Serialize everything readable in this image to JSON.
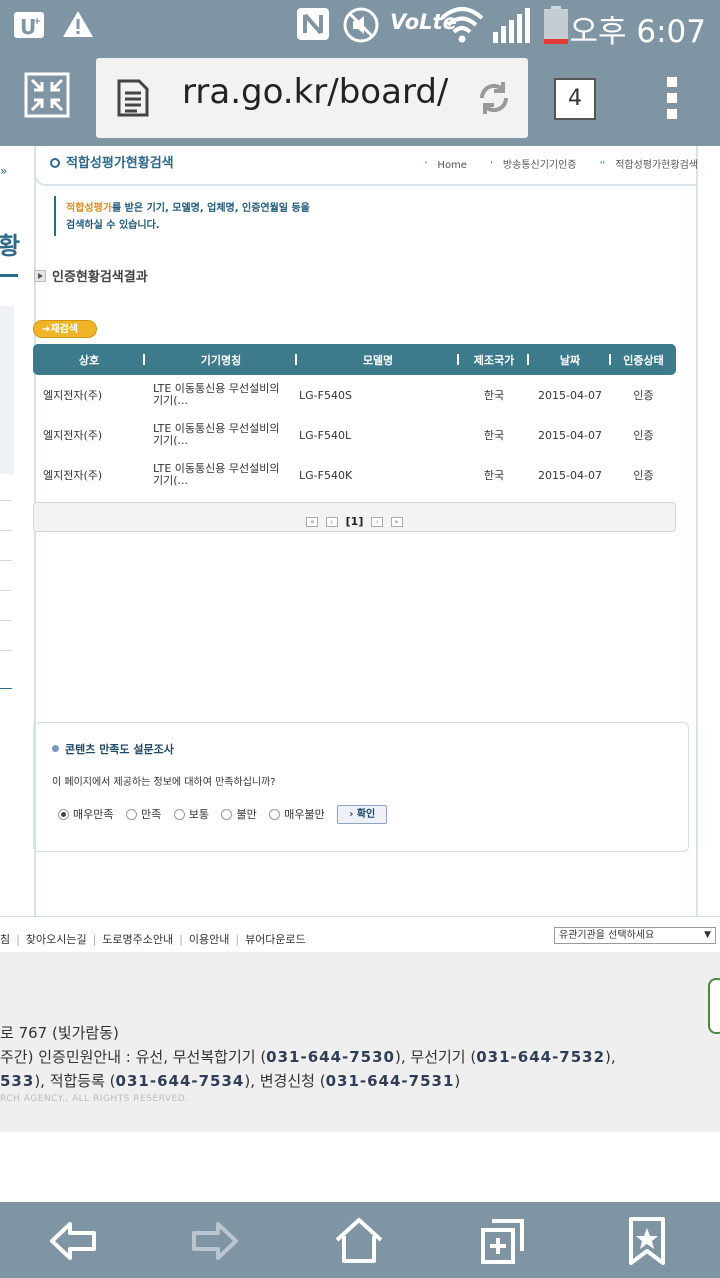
{
  "status_bar": {
    "time": "오후 6:07",
    "icons": [
      "uplus-icon",
      "warning-icon",
      "nfc-icon",
      "mute-icon",
      "volte-icon",
      "wifi-icon",
      "signal-icon",
      "battery-icon"
    ],
    "volte_label": "VoLte"
  },
  "browser": {
    "url": "rra.go.kr/board/c",
    "tab_count": "4",
    "icons": [
      "collapse-icon",
      "reader-icon",
      "reload-icon",
      "more-icon"
    ]
  },
  "page": {
    "title": "적합성평가현황검색",
    "breadcrumb": [
      "Home",
      "방송통신기기인증",
      "적합성평가현황검색"
    ],
    "description_highlight": "적합성평가",
    "description_rest1": "를 받은 기기, 모델명, 업체명, 인증연월일 등을",
    "description_line2": "검색하실 수 있습니다.",
    "section_title": "인증현황검색결과",
    "research_button": "재검색",
    "table": {
      "headers": [
        "상호",
        "기기명칭",
        "모델명",
        "제조국가",
        "날짜",
        "인증상태"
      ],
      "rows": [
        {
          "company": "엘지전자(주)",
          "device_l1": "LTE 이동통신용 무선설비의",
          "device_l2": "기기(...",
          "model": "LG-F540S",
          "country": "한국",
          "date": "2015-04-07",
          "status": "인증"
        },
        {
          "company": "엘지전자(주)",
          "device_l1": "LTE 이동통신용 무선설비의",
          "device_l2": "기기(...",
          "model": "LG-F540L",
          "country": "한국",
          "date": "2015-04-07",
          "status": "인증"
        },
        {
          "company": "엘지전자(주)",
          "device_l1": "LTE 이동통신용 무선설비의",
          "device_l2": "기기(...",
          "model": "LG-F540K",
          "country": "한국",
          "date": "2015-04-07",
          "status": "인증"
        }
      ]
    },
    "pager": {
      "current": "[1]"
    },
    "survey": {
      "title": "콘텐츠 만족도 설문조사",
      "question": "이 페이지에서 제공하는 정보에 대하여 만족하십니까?",
      "options": [
        "매우만족",
        "만족",
        "보통",
        "불만",
        "매우불만"
      ],
      "selected": "매우만족",
      "confirm": "확인"
    },
    "side_heading_fragment": "황"
  },
  "footer": {
    "links": [
      "침",
      "찾아오시는길",
      "도로명주소안내",
      "이용안내",
      "뷰어다운로드"
    ],
    "org_select": "유관기관을 선택하세요",
    "address": "로 767 (빛가람동)",
    "line2_prefix": "주간) 인증민원안내 : 유선, 무선복합기기 (",
    "phone1": "031-644-7530",
    "line2_mid": "), 무선기기 (",
    "phone2": "031-644-7532",
    "line2_suffix": "),",
    "line3_start": "533",
    "line3_mid": "), 적합등록 (",
    "phone3": "031-644-7534",
    "line3_mid2": "), 변경신청 (",
    "phone4": "031-644-7531",
    "line3_end": ")",
    "copyright": "RCH AGENCY., ALL RIGHTS RESERVED."
  },
  "bottom_nav": {
    "icons": [
      "back-icon",
      "forward-icon",
      "home-icon",
      "new-tab-icon",
      "bookmark-icon"
    ]
  }
}
